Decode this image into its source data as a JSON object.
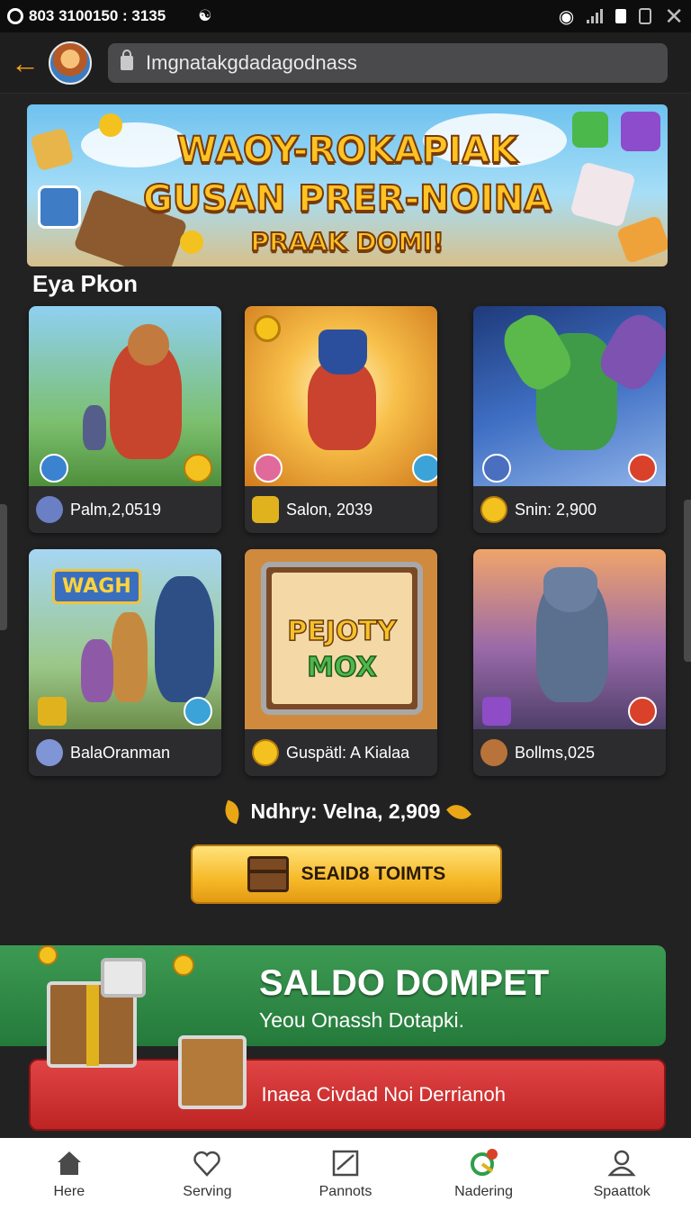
{
  "status_bar": {
    "left_text": "803  3100150 : 3135"
  },
  "address_bar": {
    "url": "Imgnatakgdadagodnass"
  },
  "banner": {
    "line1": "WAOY-ROKAPIAK",
    "line2": "GUSAN PRER-NOINA",
    "line3": "PRAAK DOMI!"
  },
  "section_title": "Eya Pkon",
  "games": [
    {
      "label": "Palm,2,0519",
      "icon": "gamer-icon"
    },
    {
      "label": "Salon, 2039",
      "icon": "gear-coin-icon"
    },
    {
      "label": "Snin: 2,900",
      "icon": "coin-icon"
    },
    {
      "label": "BalaOranman",
      "icon": "character-icon"
    },
    {
      "label": "Guspätl: A Kialaa",
      "icon": "coin-icon"
    },
    {
      "label": "Bollms,025",
      "icon": "fox-icon"
    }
  ],
  "game_art_text": {
    "wagh": "WAGH",
    "puzzle_line1": "PEJOTY",
    "puzzle_line2": "MOX"
  },
  "reward_line": "Ndhry: Velna, 2,909",
  "search_button": "SEAID8 TOIMTS",
  "saldo": {
    "title": "SALDO DOMPET",
    "subtitle": "Yeou Onassh Dotapki."
  },
  "red_button": "Inaea Civdad Noi Derrianoh",
  "bottom_nav": [
    {
      "label": "Here",
      "icon": "home-icon"
    },
    {
      "label": "Serving",
      "icon": "heart-icon"
    },
    {
      "label": "Pannots",
      "icon": "chart-icon"
    },
    {
      "label": "Nadering",
      "icon": "notification-icon"
    },
    {
      "label": "Spaattok",
      "icon": "profile-icon"
    }
  ],
  "colors": {
    "background": "#222223",
    "accent_gold": "#f6b928",
    "saldo_green": "#2d8a45",
    "button_red": "#cf3030"
  }
}
